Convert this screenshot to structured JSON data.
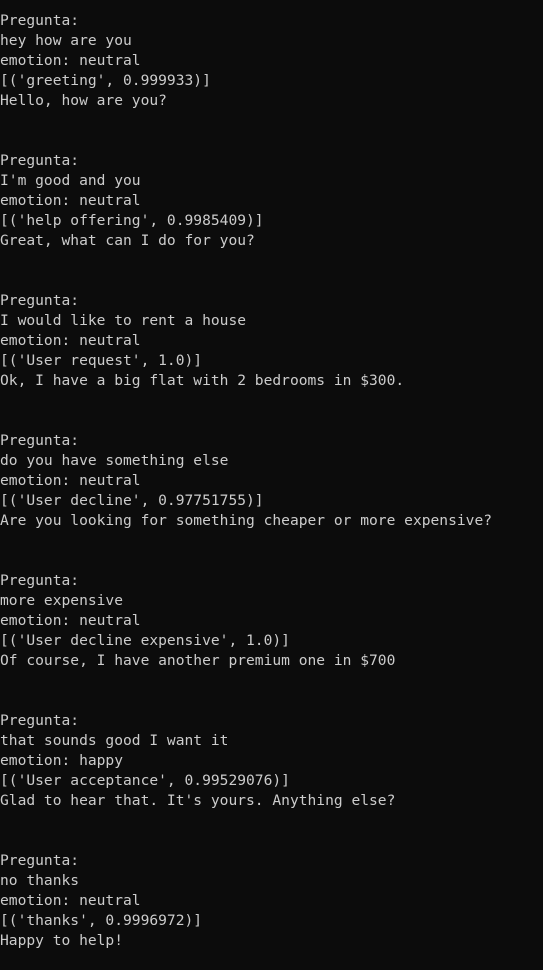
{
  "exchanges": [
    {
      "prompt_label": "Pregunta:",
      "user_input": "hey how are you",
      "emotion": "emotion: neutral",
      "intent": "[('greeting', 0.999933)]",
      "response": "Hello, how are you?"
    },
    {
      "prompt_label": "Pregunta:",
      "user_input": "I'm good and you",
      "emotion": "emotion: neutral",
      "intent": "[('help offering', 0.9985409)]",
      "response": "Great, what can I do for you?"
    },
    {
      "prompt_label": "Pregunta:",
      "user_input": "I would like to rent a house",
      "emotion": "emotion: neutral",
      "intent": "[('User request', 1.0)]",
      "response": "Ok, I have a big flat with 2 bedrooms in $300."
    },
    {
      "prompt_label": "Pregunta:",
      "user_input": "do you have something else",
      "emotion": "emotion: neutral",
      "intent": "[('User decline', 0.97751755)]",
      "response": "Are you looking for something cheaper or more expensive?"
    },
    {
      "prompt_label": "Pregunta:",
      "user_input": "more expensive",
      "emotion": "emotion: neutral",
      "intent": "[('User decline expensive', 1.0)]",
      "response": "Of course, I have another premium one in $700"
    },
    {
      "prompt_label": "Pregunta:",
      "user_input": "that sounds good I want it",
      "emotion": "emotion: happy",
      "intent": "[('User acceptance', 0.99529076)]",
      "response": "Glad to hear that. It's yours. Anything else?"
    },
    {
      "prompt_label": "Pregunta:",
      "user_input": "no thanks",
      "emotion": "emotion: neutral",
      "intent": "[('thanks', 0.9996972)]",
      "response": "Happy to help!"
    }
  ]
}
